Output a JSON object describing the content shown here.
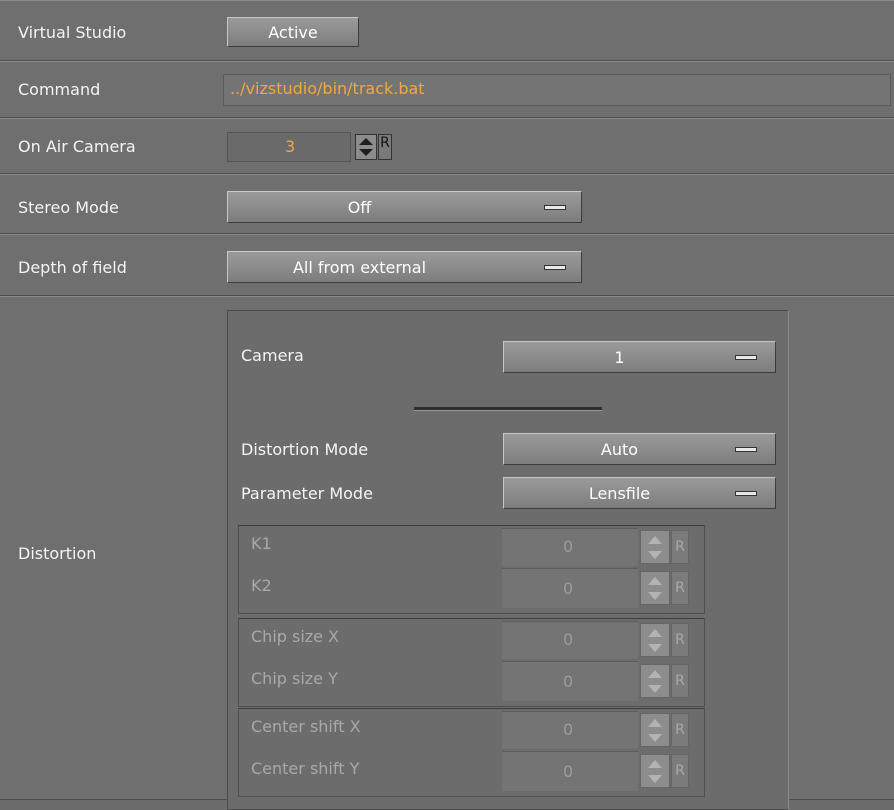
{
  "virtual_studio": {
    "label": "Virtual Studio",
    "button": "Active"
  },
  "command": {
    "label": "Command",
    "value": "../vizstudio/bin/track.bat"
  },
  "on_air_camera": {
    "label": "On Air Camera",
    "value": "3",
    "reset": "R"
  },
  "stereo_mode": {
    "label": "Stereo Mode",
    "value": "Off"
  },
  "depth_of_field": {
    "label": "Depth of field",
    "value": "All from external"
  },
  "distortion": {
    "label": "Distortion",
    "camera": {
      "label": "Camera",
      "value": "1"
    },
    "distortion_mode": {
      "label": "Distortion Mode",
      "value": "Auto"
    },
    "parameter_mode": {
      "label": "Parameter Mode",
      "value": "Lensfile"
    },
    "k1": {
      "label": "K1",
      "value": "0",
      "reset": "R"
    },
    "k2": {
      "label": "K2",
      "value": "0",
      "reset": "R"
    },
    "chip_x": {
      "label": "Chip size X",
      "value": "0",
      "reset": "R"
    },
    "chip_y": {
      "label": "Chip size Y",
      "value": "0",
      "reset": "R"
    },
    "center_x": {
      "label": "Center shift X",
      "value": "0",
      "reset": "R"
    },
    "center_y": {
      "label": "Center shift Y",
      "value": "0",
      "reset": "R"
    }
  },
  "colors": {
    "accent_orange": "#f2a742",
    "panel": "#6f6f6f"
  }
}
